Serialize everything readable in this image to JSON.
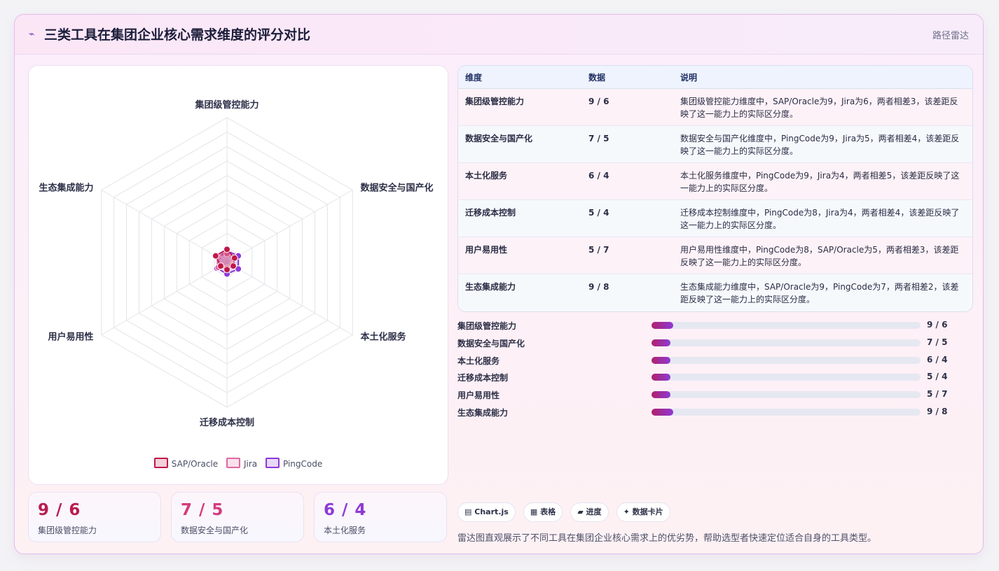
{
  "header": {
    "icon": "pulse-icon",
    "title": "三类工具在集团企业核心需求维度的评分对比",
    "tag": "路径雷达"
  },
  "colors": {
    "sap": "#c0184a",
    "jira": "#e0689f",
    "pingcode": "#8e3ad6"
  },
  "chart_data": {
    "type": "radar",
    "axes": [
      "集团级管控能力",
      "数据安全与国产化",
      "本土化服务",
      "迁移成本控制",
      "用户易用性",
      "生态集成能力"
    ],
    "series": [
      {
        "name": "SAP/Oracle",
        "values": [
          9,
          6,
          5,
          5,
          5,
          9
        ]
      },
      {
        "name": "Jira",
        "values": [
          6,
          5,
          4,
          4,
          7,
          8
        ]
      },
      {
        "name": "PingCode",
        "values": [
          8,
          9,
          9,
          8,
          8,
          7
        ]
      }
    ],
    "scale_max": 100,
    "grid_levels": 10
  },
  "legend": [
    "SAP/Oracle",
    "Jira",
    "PingCode"
  ],
  "stats": [
    {
      "value": "9 / 6",
      "label": "集团级管控能力"
    },
    {
      "value": "7 / 5",
      "label": "数据安全与国产化"
    },
    {
      "value": "6 / 4",
      "label": "本土化服务"
    }
  ],
  "table": {
    "headers": [
      "维度",
      "数据",
      "说明"
    ],
    "rows": [
      {
        "dim": "集团级管控能力",
        "val": "9 / 6",
        "desc": "集团级管控能力维度中，SAP/Oracle为9，Jira为6，两者相差3，该差距反映了这一能力上的实际区分度。"
      },
      {
        "dim": "数据安全与国产化",
        "val": "7 / 5",
        "desc": "数据安全与国产化维度中，PingCode为9，Jira为5，两者相差4，该差距反映了这一能力上的实际区分度。"
      },
      {
        "dim": "本土化服务",
        "val": "6 / 4",
        "desc": "本土化服务维度中，PingCode为9，Jira为4，两者相差5，该差距反映了这一能力上的实际区分度。"
      },
      {
        "dim": "迁移成本控制",
        "val": "5 / 4",
        "desc": "迁移成本控制维度中，PingCode为8，Jira为4，两者相差4，该差距反映了这一能力上的实际区分度。"
      },
      {
        "dim": "用户易用性",
        "val": "5 / 7",
        "desc": "用户易用性维度中，PingCode为8，SAP/Oracle为5，两者相差3，该差距反映了这一能力上的实际区分度。"
      },
      {
        "dim": "生态集成能力",
        "val": "9 / 8",
        "desc": "生态集成能力维度中，SAP/Oracle为9，PingCode为7，两者相差2，该差距反映了这一能力上的实际区分度。"
      }
    ]
  },
  "bars": [
    {
      "label": "集团级管控能力",
      "value": "9 / 6",
      "level": 0.08
    },
    {
      "label": "数据安全与国产化",
      "value": "7 / 5",
      "level": 0.07
    },
    {
      "label": "本土化服务",
      "value": "6 / 4",
      "level": 0.07
    },
    {
      "label": "迁移成本控制",
      "value": "5 / 4",
      "level": 0.07
    },
    {
      "label": "用户易用性",
      "value": "5 / 7",
      "level": 0.07
    },
    {
      "label": "生态集成能力",
      "value": "9 / 8",
      "level": 0.08
    }
  ],
  "chips": [
    {
      "icon": "chart-icon",
      "glyph": "▤",
      "label": "Chart.js"
    },
    {
      "icon": "table-icon",
      "glyph": "▦",
      "label": "表格"
    },
    {
      "icon": "progress-icon",
      "glyph": "▰",
      "label": "进度"
    },
    {
      "icon": "sparkle-icon",
      "glyph": "✦",
      "label": "数据卡片"
    }
  ],
  "footnote": "雷达图直观展示了不同工具在集团企业核心需求上的优劣势，帮助选型者快速定位适合自身的工具类型。"
}
